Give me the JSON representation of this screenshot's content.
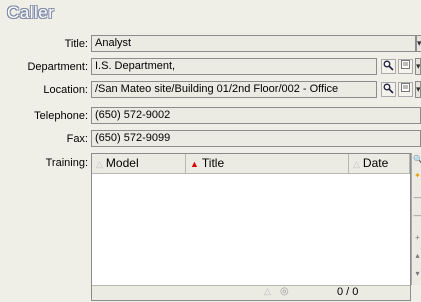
{
  "section_title": "Caller",
  "fields": {
    "title": {
      "label": "Title:",
      "value": "Analyst"
    },
    "department": {
      "label": "Department:",
      "value": "I.S. Department,"
    },
    "location": {
      "label": "Location:",
      "value": "/San Mateo site/Building 01/2nd Floor/002 - Office"
    },
    "telephone": {
      "label": "Telephone:",
      "value": "(650) 572-9002"
    },
    "fax": {
      "label": "Fax:",
      "value": "(650) 572-9099"
    }
  },
  "training": {
    "label": "Training:",
    "columns": [
      "Model",
      "Title",
      "Date"
    ],
    "sort_column": "Title",
    "rows": [],
    "counter": "0 / 0"
  },
  "icons": {
    "magnifier": "magnifier-icon",
    "detail": "detail-icon",
    "dropdown": "dropdown-arrow-icon"
  }
}
